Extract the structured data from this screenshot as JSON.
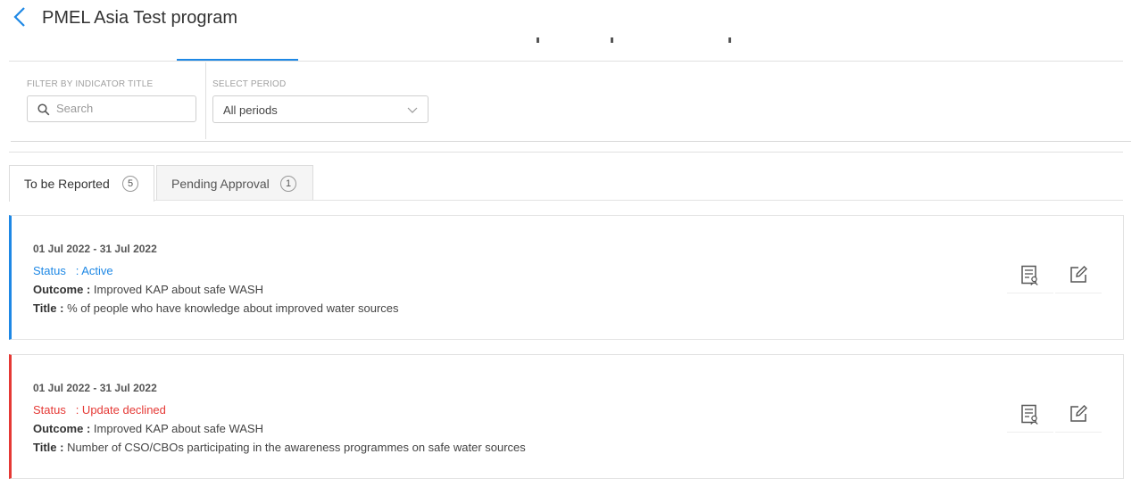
{
  "header": {
    "title": "PMEL Asia Test program"
  },
  "filters": {
    "indicator_label": "FILTER BY INDICATOR TITLE",
    "search_placeholder": "Search",
    "period_label": "SELECT PERIOD",
    "period_value": "All periods"
  },
  "tabs": [
    {
      "label": "To be Reported",
      "count": "5"
    },
    {
      "label": "Pending Approval",
      "count": "1"
    }
  ],
  "cards": [
    {
      "date": "01 Jul 2022 - 31 Jul 2022",
      "status_key": "Status",
      "status_value": ": Active",
      "outcome_key": "Outcome :",
      "outcome_value": "Improved KAP about safe WASH",
      "title_key": "Title :",
      "title_value": "% of people who have knowledge about improved water sources"
    },
    {
      "date": "01 Jul 2022 - 31 Jul 2022",
      "status_key": "Status",
      "status_value": ": Update declined",
      "outcome_key": "Outcome :",
      "outcome_value": "Improved KAP about safe WASH",
      "title_key": "Title :",
      "title_value": "Number of CSO/CBOs participating in the awareness programmes on safe water sources"
    }
  ],
  "colors": {
    "accent": "#1e88e5",
    "declined": "#e53935"
  }
}
